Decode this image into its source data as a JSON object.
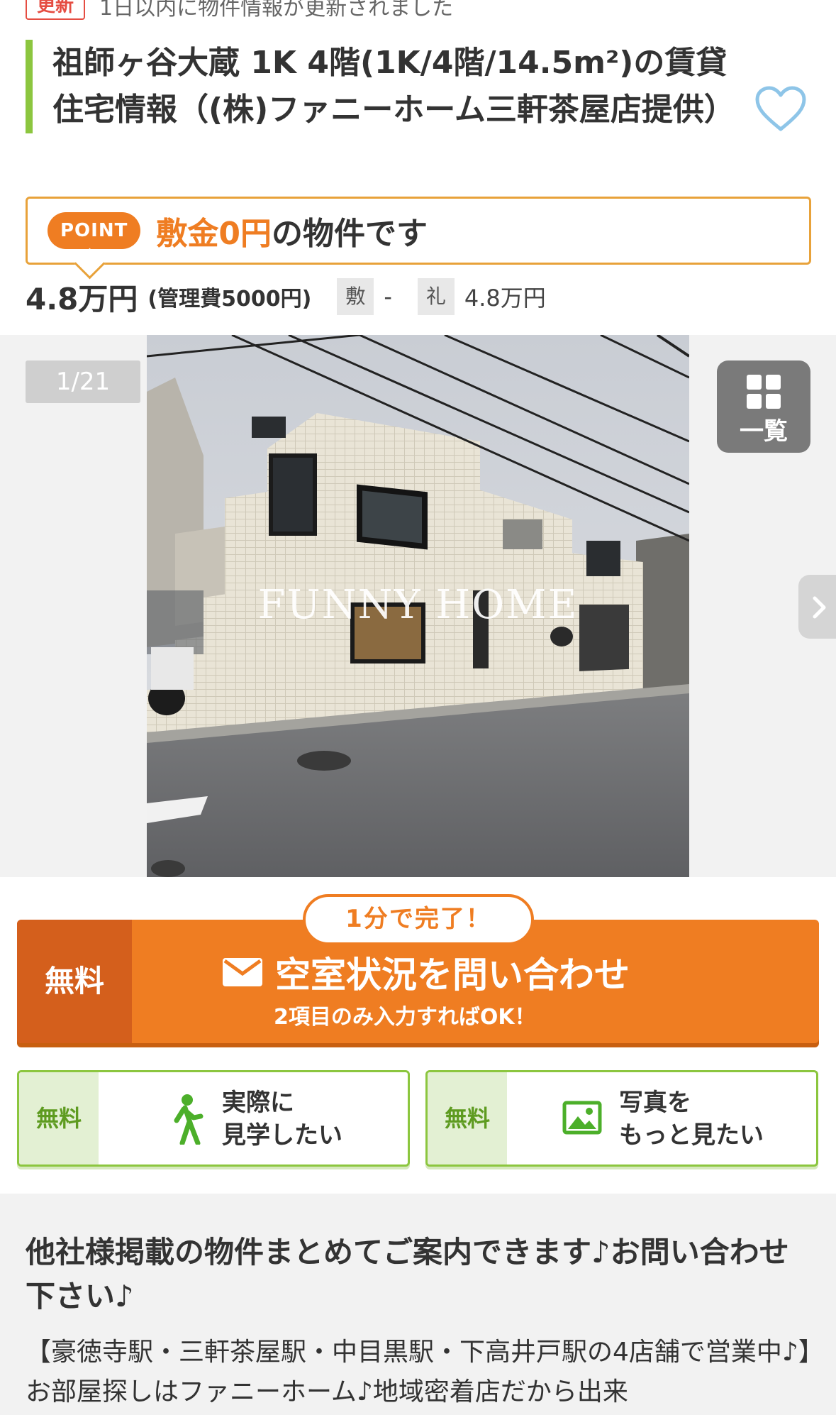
{
  "update": {
    "badge": "更新",
    "text": "1日以内に物件情報が更新されました"
  },
  "listing": {
    "title": "祖師ヶ谷大蔵 1K 4階(1K/4階/14.5m²)の賃貸住宅情報（(株)ファニーホーム三軒茶屋店提供）",
    "favorite_icon": "heart-outline-icon"
  },
  "point": {
    "pill": "POINT",
    "highlight": "敷金0円",
    "rest": "の物件です"
  },
  "price": {
    "rent": "4.8万円",
    "fee": "(管理費5000円)",
    "deposit_label": "敷",
    "deposit_value": "-",
    "key_money_label": "礼",
    "key_money_value": "4.8万円"
  },
  "gallery": {
    "counter": "1/21",
    "list_label": "一覧",
    "watermark": "FUNNY HOME"
  },
  "cta": {
    "badge": "1分で完了！",
    "free": "無料",
    "title": "空室状況を問い合わせ",
    "sub": "2項目のみ入力すればOK！",
    "visit_free": "無料",
    "visit_label_1": "実際に",
    "visit_label_2": "見学したい",
    "photo_free": "無料",
    "photo_label_1": "写真を",
    "photo_label_2": "もっと見たい"
  },
  "info": {
    "title": "他社様掲載の物件まとめてご案内できます♪お問い合わせ下さい♪",
    "body": "【豪徳寺駅・三軒茶屋駅・中目黒駅・下高井戸駅の4店舗で営業中♪】お部屋探しはファニーホーム♪地域密着店だから出来"
  },
  "colors": {
    "accent_orange": "#ef7d22",
    "accent_green": "#8cc63f",
    "update_red": "#e54d42"
  }
}
